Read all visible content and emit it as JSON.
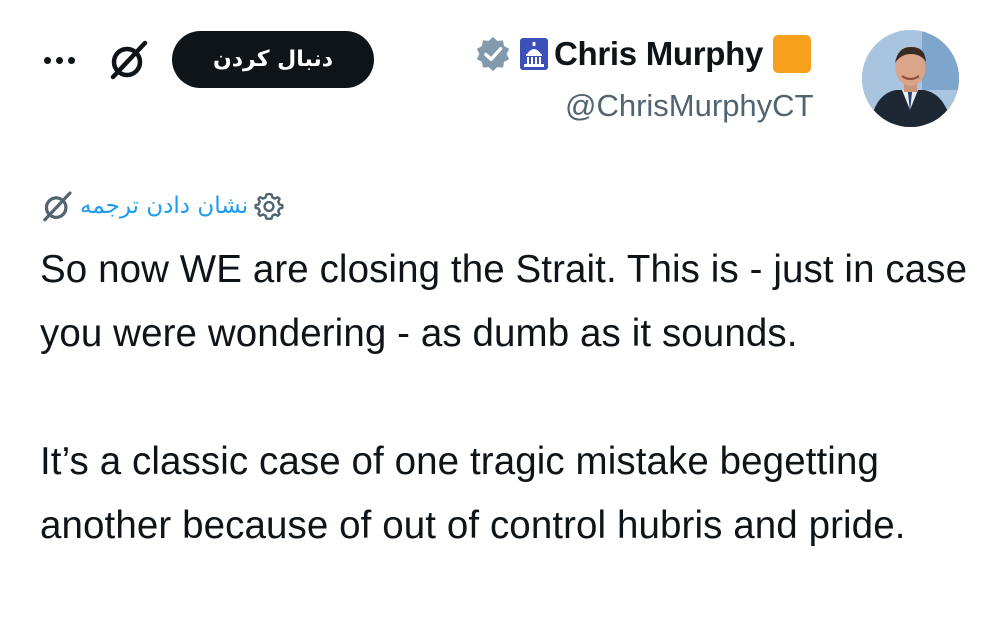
{
  "header": {
    "more_label": "More",
    "grok_icon": "grok-icon",
    "follow_label": "دنبال کردن"
  },
  "author": {
    "display_name": "Chris Murphy",
    "handle": "@ChrisMurphyCT",
    "verified_icon": "verified-badge-icon",
    "affiliation_icon": "capitol-building-icon",
    "emoji_icon": "orange-square-icon",
    "square_color": "#f7a01e"
  },
  "translate": {
    "label": "نشان دادن ترجمه",
    "icon": "gear-icon",
    "link_color": "#1d9bf0"
  },
  "tweet": {
    "paragraphs": [
      "So now WE are closing the Strait. This is - just in case you were wondering - as dumb as it sounds.",
      "It’s a classic case of one tragic mistake begetting another because of out of control hubris and pride."
    ]
  },
  "colors": {
    "text": "#0f1419",
    "secondary": "#536471",
    "accent": "#1d9bf0"
  }
}
